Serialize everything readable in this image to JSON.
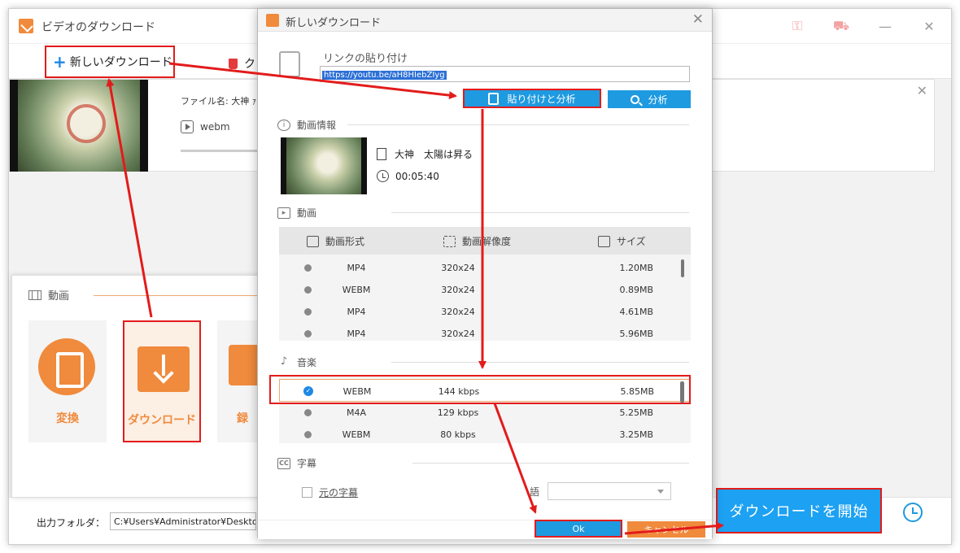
{
  "app": {
    "title": "ビデオのダウンロード",
    "toolbar": {
      "new_download": "新しいダウンロード",
      "clear": "ク"
    },
    "task": {
      "file_name": "ファイル名: 大神 ｧ",
      "format": "webm"
    },
    "output": {
      "label": "出力フォルダ：",
      "path": "C:¥Users¥Administrator¥Desktop"
    },
    "start_button": "ダウンロードを開始",
    "titlebar_icons": [
      "key-icon",
      "cart-icon",
      "minimize-icon",
      "close-icon"
    ]
  },
  "category_panel": {
    "section": "動画",
    "cards": [
      {
        "label": "変換"
      },
      {
        "label": "ダウンロード"
      },
      {
        "label": "録"
      }
    ]
  },
  "dialog": {
    "title": "新しいダウンロード",
    "link_label": "リンクの貼り付け",
    "url": "https://youtu.be/aH8HIebZIyg",
    "paste_button": "貼り付けと分析",
    "analyze_button": "分析",
    "info_section": "動画情報",
    "video_title": "大神　太陽は昇る",
    "duration": "00:05:40",
    "video_section": "動画",
    "columns": {
      "format": "動画形式",
      "resolution": "動画解像度",
      "size": "サイズ"
    },
    "video_rows": [
      {
        "format": "MP4",
        "resolution": "320x24",
        "size": "1.20MB"
      },
      {
        "format": "WEBM",
        "resolution": "320x24",
        "size": "0.89MB"
      },
      {
        "format": "MP4",
        "resolution": "320x24",
        "size": "4.61MB"
      },
      {
        "format": "MP4",
        "resolution": "320x24",
        "size": "5.96MB"
      }
    ],
    "music_section": "音楽",
    "music_rows": [
      {
        "format": "WEBM",
        "bitrate": "144 kbps",
        "size": "5.85MB",
        "selected": true
      },
      {
        "format": "M4A",
        "bitrate": "129 kbps",
        "size": "5.25MB",
        "selected": false
      },
      {
        "format": "WEBM",
        "bitrate": "80 kbps",
        "size": "3.25MB",
        "selected": false
      }
    ],
    "subtitle_section": "字幕",
    "original_subtitle": "元の字幕",
    "language_label": "語",
    "ok_button": "Ok",
    "cancel_button": "キャンセル"
  },
  "colors": {
    "accent_orange": "#f08a3c",
    "accent_blue": "#1e9ae0",
    "highlight_red": "#e31b1b"
  }
}
